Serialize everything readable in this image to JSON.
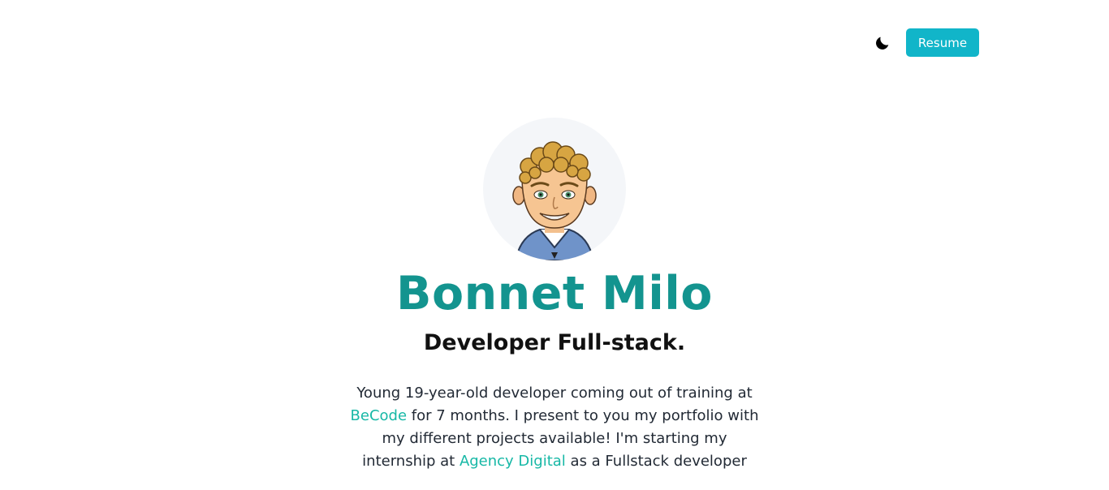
{
  "header": {
    "theme_toggle_icon": "moon-icon",
    "resume_label": "Resume",
    "accent_color": "#11b5c9"
  },
  "hero": {
    "avatar_icon": "avatar-emoji",
    "name": "Bonnet Milo",
    "name_color": "#13948f",
    "role": "Developer Full-stack.",
    "bio": {
      "part1": "Young 19-year-old developer coming out of training at ",
      "link1": "BeCode",
      "part2": " for 7 months. I present to you my portfolio with my different projects available! I'm starting my internship at ",
      "link2": "Agency Digital",
      "part3": " as a Fullstack developer",
      "link_color": "#17b8a6"
    }
  }
}
